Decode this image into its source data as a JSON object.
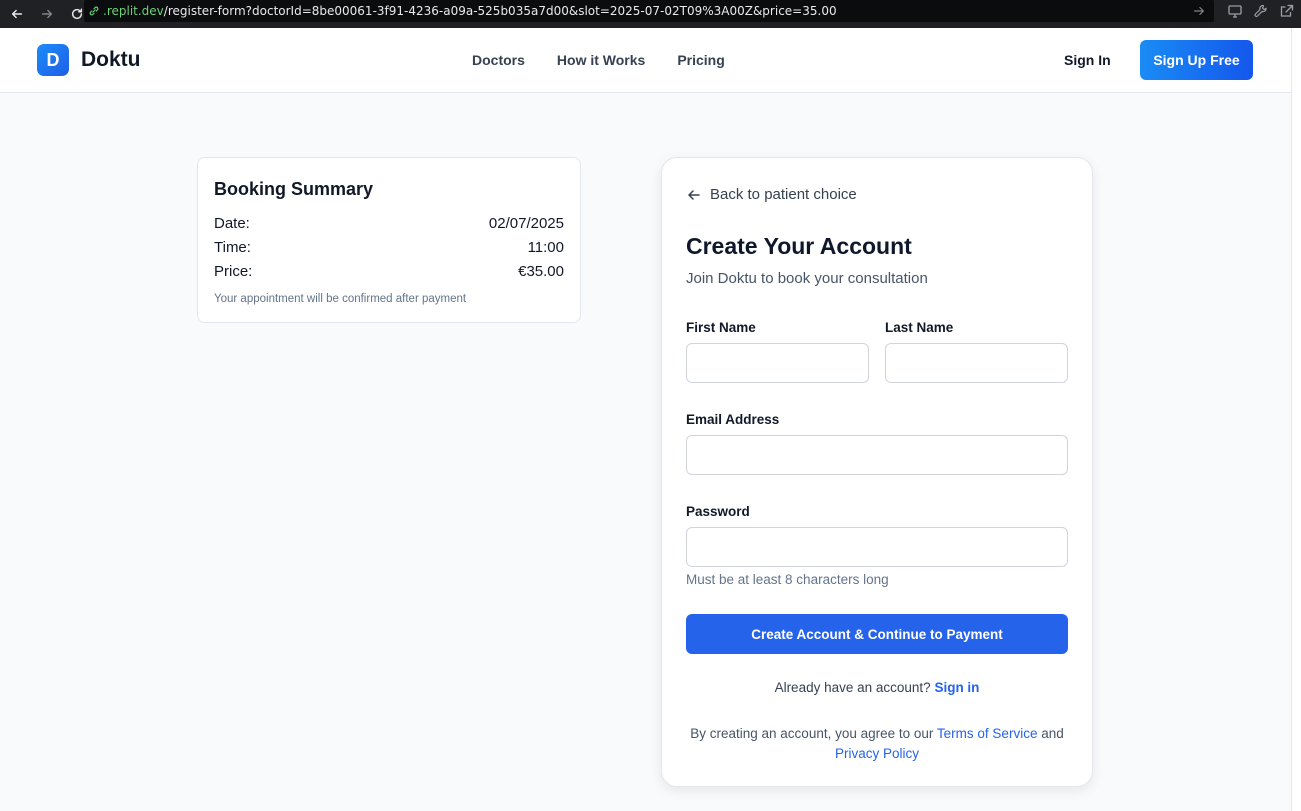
{
  "browser": {
    "url_host": ".replit.dev",
    "url_path": "/register-form?doctorId=8be00061-3f91-4236-a09a-525b035a7d00&slot=2025-07-02T09%3A00Z&price=35.00"
  },
  "header": {
    "logo_letter": "D",
    "brand": "Doktu",
    "nav": [
      "Doctors",
      "How it Works",
      "Pricing"
    ],
    "sign_in": "Sign In",
    "sign_up": "Sign Up Free"
  },
  "summary": {
    "title": "Booking Summary",
    "rows": [
      {
        "label": "Date:",
        "value": "02/07/2025"
      },
      {
        "label": "Time:",
        "value": "11:00"
      },
      {
        "label": "Price:",
        "value": "€35.00"
      }
    ],
    "note": "Your appointment will be confirmed after payment"
  },
  "form": {
    "back_label": "Back to patient choice",
    "title": "Create Your Account",
    "subtitle": "Join Doktu to book your consultation",
    "first_name_label": "First Name",
    "first_name_value": "",
    "last_name_label": "Last Name",
    "last_name_value": "",
    "email_label": "Email Address",
    "email_value": "",
    "password_label": "Password",
    "password_value": "",
    "password_hint": "Must be at least 8 characters long",
    "submit_label": "Create Account & Continue to Payment",
    "already_text": "Already have an account?",
    "sign_in_link": "Sign in",
    "terms_prefix": "By creating an account, you agree to our",
    "terms_link": "Terms of Service",
    "terms_and": "and",
    "privacy_link": "Privacy Policy"
  },
  "colors": {
    "accent": "#2563eb",
    "brand_gradient_start": "#1a8cf5",
    "page_bg": "#f8fafc"
  }
}
